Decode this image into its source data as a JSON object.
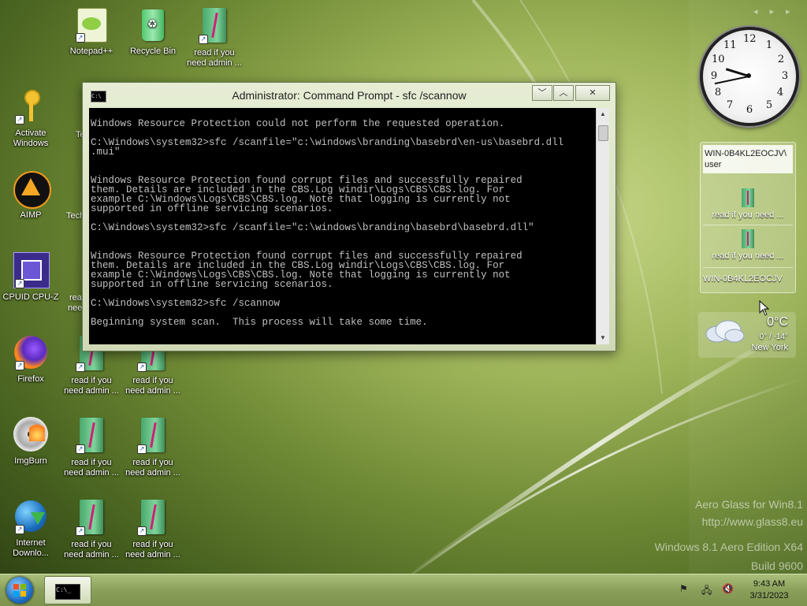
{
  "desktop": {
    "icons": [
      {
        "label": "Notepad++"
      },
      {
        "label": "Recycle Bin"
      },
      {
        "label": "read if you need admin ..."
      },
      {
        "label": "Activate Windows"
      },
      {
        "label": "AIMP"
      },
      {
        "label": "CPUID CPU-Z"
      },
      {
        "label": "Firefox"
      },
      {
        "label": "read if you need admin ..."
      },
      {
        "label": "read if you need admin ..."
      },
      {
        "label": "ImgBurn"
      },
      {
        "label": "read if you need admin ..."
      },
      {
        "label": "read if you need admin ..."
      },
      {
        "label": "Internet Downlo..."
      },
      {
        "label": "read if you need admin ..."
      },
      {
        "label": "read if you need admin ..."
      }
    ],
    "partial_labels": [
      "Te",
      "Tech",
      "rea",
      "nee"
    ]
  },
  "cmd_window": {
    "title": "Administrator: Command Prompt - sfc  /scannow",
    "lines": "\nWindows Resource Protection could not perform the requested operation.\n\nC:\\Windows\\system32>sfc /scanfile=\"c:\\windows\\branding\\basebrd\\en-us\\basebrd.dll\n.mui\"\n\n\nWindows Resource Protection found corrupt files and successfully repaired\nthem. Details are included in the CBS.Log windir\\Logs\\CBS\\CBS.log. For\nexample C:\\Windows\\Logs\\CBS\\CBS.log. Note that logging is currently not\nsupported in offline servicing scenarios.\n\nC:\\Windows\\system32>sfc /scanfile=\"c:\\windows\\branding\\basebrd\\basebrd.dll\"\n\n\nWindows Resource Protection found corrupt files and successfully repaired\nthem. Details are included in the CBS.Log windir\\Logs\\CBS\\CBS.log. For\nexample C:\\Windows\\Logs\\CBS\\CBS.log. Note that logging is currently not\nsupported in offline servicing scenarios.\n\nC:\\Windows\\system32>sfc /scannow\n\nBeginning system scan.  This process will take some time.\n\n_",
    "icon_text": "C:\\"
  },
  "gadgets": {
    "clock_numbers": [
      "12",
      "1",
      "2",
      "3",
      "4",
      "5",
      "6",
      "7",
      "8",
      "9",
      "10",
      "11"
    ],
    "clock_time": "9:43",
    "network": {
      "selected": "WIN-0B4KL2EOCJV\\ user",
      "items": [
        "read if you need ...",
        "read if you need ..."
      ],
      "last": "WIN-0B4KL2EOCJV"
    },
    "weather": {
      "temp": "0°C",
      "range": "0° / -14°",
      "city": "New York"
    }
  },
  "watermark": {
    "line1": "Aero Glass for Win8.1",
    "line2": "http://www.glass8.eu",
    "line3": "Windows 8.1 Aero Edition X64",
    "line4": "Build 9600"
  },
  "taskbar": {
    "time": "9:43 AM",
    "date": "3/31/2023",
    "cmd_icon_text": "C:\\_"
  }
}
